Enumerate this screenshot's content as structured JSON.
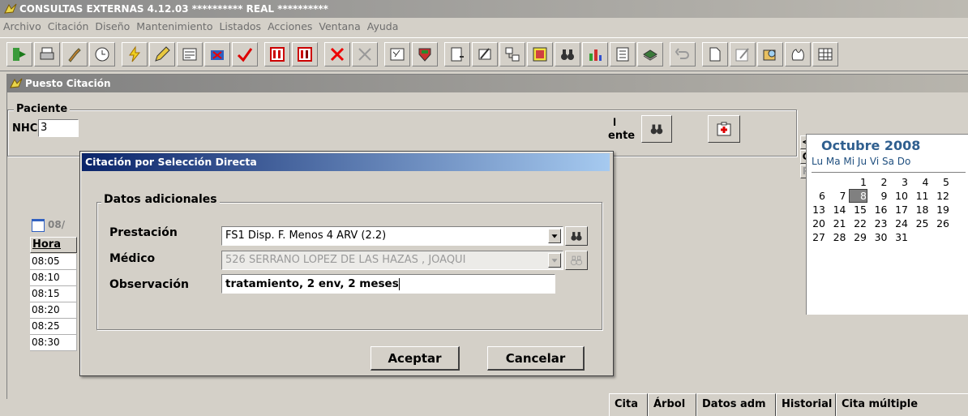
{
  "window": {
    "title": "CONSULTAS EXTERNAS 4.12.03 ********** REAL **********"
  },
  "menu": [
    "Archivo",
    "Citación",
    "Diseño",
    "Mantenimiento",
    "Listados",
    "Acciones",
    "Ventana",
    "Ayuda"
  ],
  "toolbar": {
    "icons": [
      "exit-icon",
      "print-icon",
      "tools-icon",
      "clock-icon",
      "lightning-icon",
      "pencil-icon",
      "form-icon",
      "cancel-appointment-icon",
      "check-icon",
      "calendar-red-icon",
      "calendar-red-2-icon",
      "delete-icon",
      "delete-disabled-icon",
      "properties-icon",
      "shield-icon",
      "document-arrow-icon",
      "edit-icon",
      "network-icon",
      "image-icon",
      "binoculars-icon",
      "chart-icon",
      "list-icon",
      "book-icon",
      "undo-icon",
      "new-document-icon",
      "report-icon",
      "search-folder-icon",
      "hands-icon",
      "grid-icon"
    ]
  },
  "puesto": {
    "title": "Puesto Citación",
    "paciente_label": "Paciente",
    "nhc_label": "NHC",
    "nhc_value": "3",
    "right_label_top": "l",
    "right_label_bottom": "ente",
    "date_tab": "08/",
    "hora_header": "Hora",
    "hours": [
      "08:05",
      "08:10",
      "08:15",
      "08:20",
      "08:25",
      "08:30"
    ],
    "tabs": [
      "Cita",
      "Árbol",
      "Datos adm",
      "Historial",
      "Cita múltiple"
    ],
    "nav_buttons": [
      "<",
      "C",
      "P"
    ]
  },
  "calendar": {
    "month": "Octubre 2008",
    "dow": "Lu Ma Mi Ju Vi Sa Do",
    "weeks": [
      [
        "",
        "",
        "1",
        "2",
        "3",
        "4",
        "5"
      ],
      [
        "6",
        "7",
        "8",
        "9",
        "10",
        "11",
        "12"
      ],
      [
        "13",
        "14",
        "15",
        "16",
        "17",
        "18",
        "19"
      ],
      [
        "20",
        "21",
        "22",
        "23",
        "24",
        "25",
        "26"
      ],
      [
        "27",
        "28",
        "29",
        "30",
        "31",
        "",
        ""
      ]
    ],
    "selected": "8"
  },
  "dialog": {
    "title": "Citación por Selección Directa",
    "group_label": "Datos adicionales",
    "prestacion_label": "Prestación",
    "prestacion_value": "FS1 Disp. F. Menos 4 ARV (2.2)",
    "medico_label": "Médico",
    "medico_value": "526 SERRANO LOPEZ DE LAS HAZAS , JOAQUI",
    "observacion_label": "Observación",
    "observacion_value": "tratamiento, 2 env, 2 meses",
    "accept_label": "Aceptar",
    "cancel_label": "Cancelar"
  },
  "colors": {
    "title_text": "#ffffff",
    "dialog_title": "#0a246a",
    "calendar_month": "#2f5f8f",
    "selected_day": "#808080"
  }
}
